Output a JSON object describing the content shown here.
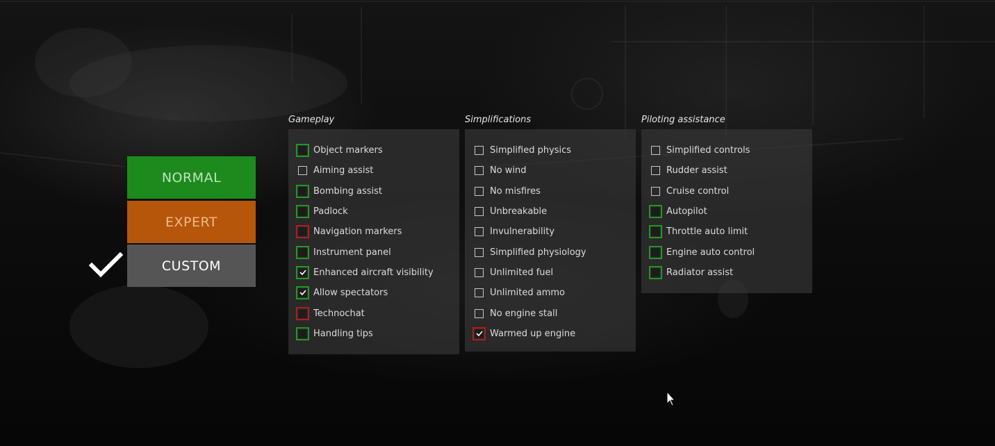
{
  "modes": {
    "normal_label": "NORMAL",
    "expert_label": "EXPERT",
    "custom_label": "CUSTOM",
    "selected": "CUSTOM"
  },
  "colors": {
    "normal": "#1d8a1d",
    "expert": "#b5560a",
    "custom": "#555555",
    "assist_on": "#1f9a1f",
    "assist_off": "#b01d1d"
  },
  "panels": {
    "gameplay": {
      "title": "Gameplay",
      "items": [
        {
          "label": "Object markers",
          "checked": false,
          "highlight": "green"
        },
        {
          "label": "Aiming assist",
          "checked": false,
          "highlight": "none"
        },
        {
          "label": "Bombing assist",
          "checked": false,
          "highlight": "green"
        },
        {
          "label": "Padlock",
          "checked": false,
          "highlight": "green"
        },
        {
          "label": "Navigation markers",
          "checked": false,
          "highlight": "red"
        },
        {
          "label": "Instrument panel",
          "checked": false,
          "highlight": "green"
        },
        {
          "label": "Enhanced aircraft visibility",
          "checked": true,
          "highlight": "green"
        },
        {
          "label": "Allow spectators",
          "checked": true,
          "highlight": "green"
        },
        {
          "label": "Technochat",
          "checked": false,
          "highlight": "red"
        },
        {
          "label": "Handling tips",
          "checked": false,
          "highlight": "green"
        }
      ]
    },
    "simplifications": {
      "title": "Simplifications",
      "items": [
        {
          "label": "Simplified physics",
          "checked": false,
          "highlight": "none"
        },
        {
          "label": "No wind",
          "checked": false,
          "highlight": "none"
        },
        {
          "label": "No misfires",
          "checked": false,
          "highlight": "none"
        },
        {
          "label": "Unbreakable",
          "checked": false,
          "highlight": "none"
        },
        {
          "label": "Invulnerability",
          "checked": false,
          "highlight": "none"
        },
        {
          "label": "Simplified physiology",
          "checked": false,
          "highlight": "none"
        },
        {
          "label": "Unlimited fuel",
          "checked": false,
          "highlight": "none"
        },
        {
          "label": "Unlimited ammo",
          "checked": false,
          "highlight": "none"
        },
        {
          "label": "No engine stall",
          "checked": false,
          "highlight": "none"
        },
        {
          "label": "Warmed up engine",
          "checked": true,
          "highlight": "red"
        }
      ]
    },
    "piloting": {
      "title": "Piloting assistance",
      "items": [
        {
          "label": "Simplified controls",
          "checked": false,
          "highlight": "none"
        },
        {
          "label": "Rudder assist",
          "checked": false,
          "highlight": "none"
        },
        {
          "label": "Cruise control",
          "checked": false,
          "highlight": "none"
        },
        {
          "label": "Autopilot",
          "checked": false,
          "highlight": "green"
        },
        {
          "label": "Throttle auto limit",
          "checked": false,
          "highlight": "green"
        },
        {
          "label": "Engine auto control",
          "checked": false,
          "highlight": "green"
        },
        {
          "label": "Radiator assist",
          "checked": false,
          "highlight": "green"
        }
      ]
    }
  }
}
